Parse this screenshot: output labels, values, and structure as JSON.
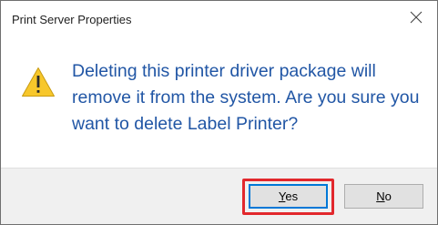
{
  "dialog": {
    "title": "Print Server Properties",
    "close_icon": "close-icon",
    "warning_icon": "warning-icon",
    "message": "Deleting this printer driver package will remove it from the system. Are you sure you want to delete Label Printer?",
    "buttons": {
      "yes": {
        "access_key": "Y",
        "rest": "es"
      },
      "no": {
        "access_key": "N",
        "rest": "o"
      }
    },
    "colors": {
      "message_text": "#2156a5",
      "highlight": "#e2282d",
      "default_button_border": "#0078d7"
    }
  }
}
